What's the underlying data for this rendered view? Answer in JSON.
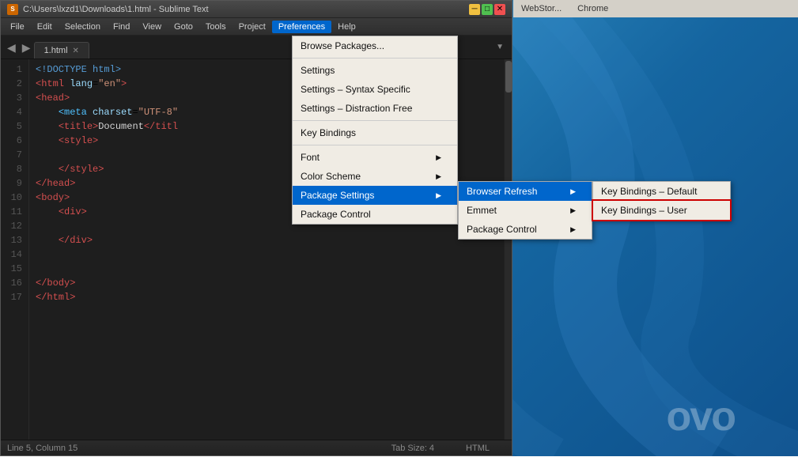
{
  "desktop": {
    "logo": "ovo"
  },
  "taskbar": {
    "items": [
      "WebStor...",
      "Chrome"
    ]
  },
  "window": {
    "title": "C:\\Users\\lxzd1\\Downloads\\1.html - Sublime Text",
    "icon": "S"
  },
  "menubar": {
    "items": [
      "File",
      "Edit",
      "Selection",
      "Find",
      "View",
      "Goto",
      "Tools",
      "Project",
      "Preferences",
      "Help"
    ],
    "active": "Preferences"
  },
  "tabs": {
    "current": "1.html"
  },
  "editor": {
    "lines": [
      {
        "num": "1",
        "code": "<!DOCTYPE html>"
      },
      {
        "num": "2",
        "code": "<html lang=\"en\">"
      },
      {
        "num": "3",
        "code": "<head>"
      },
      {
        "num": "4",
        "code": "    <meta charset=\"UTF-8\""
      },
      {
        "num": "5",
        "code": "    <title>Document</title"
      },
      {
        "num": "6",
        "code": "    <style>"
      },
      {
        "num": "7",
        "code": ""
      },
      {
        "num": "8",
        "code": "    </style>"
      },
      {
        "num": "9",
        "code": "</head>"
      },
      {
        "num": "10",
        "code": "<body>"
      },
      {
        "num": "11",
        "code": "    <div>"
      },
      {
        "num": "12",
        "code": ""
      },
      {
        "num": "13",
        "code": "    </div>"
      },
      {
        "num": "14",
        "code": ""
      },
      {
        "num": "15",
        "code": ""
      },
      {
        "num": "16",
        "code": "</body>"
      },
      {
        "num": "17",
        "code": "</html>"
      }
    ]
  },
  "statusbar": {
    "position": "Line 5, Column 15",
    "tab_size": "Tab Size: 4",
    "syntax": "HTML"
  },
  "prefs_menu": {
    "items": [
      {
        "label": "Browse Packages...",
        "has_sub": false,
        "separator_after": true
      },
      {
        "label": "Settings",
        "has_sub": false
      },
      {
        "label": "Settings – Syntax Specific",
        "has_sub": false
      },
      {
        "label": "Settings – Distraction Free",
        "has_sub": false,
        "separator_after": true
      },
      {
        "label": "Key Bindings",
        "has_sub": false,
        "separator_after": true
      },
      {
        "label": "Font",
        "has_sub": true
      },
      {
        "label": "Color Scheme",
        "has_sub": true
      },
      {
        "label": "Package Settings",
        "has_sub": true
      },
      {
        "label": "Package Control",
        "has_sub": false
      }
    ]
  },
  "pkg_settings_submenu": {
    "items": [
      {
        "label": "Browser Refresh",
        "has_sub": true
      },
      {
        "label": "Emmet",
        "has_sub": true
      },
      {
        "label": "Package Control",
        "has_sub": true
      }
    ]
  },
  "browser_refresh_submenu": {
    "items": [
      {
        "label": "Key Bindings – Default",
        "has_sub": false,
        "highlighted": false
      },
      {
        "label": "Key Bindings – User",
        "has_sub": false,
        "highlighted": true
      }
    ]
  }
}
